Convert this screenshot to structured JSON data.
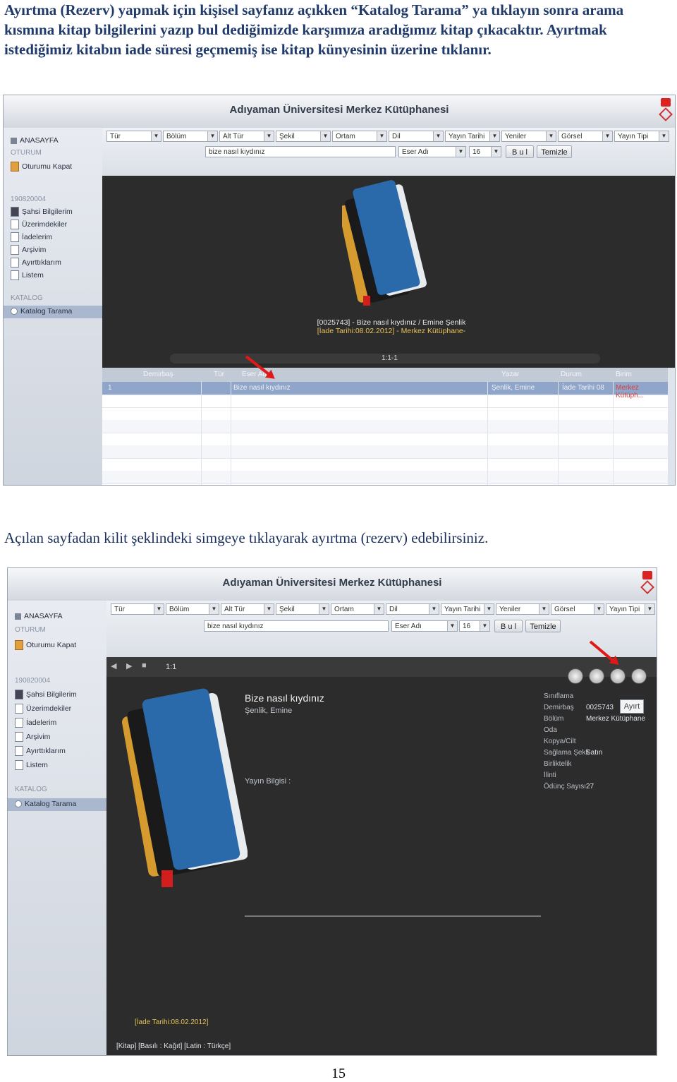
{
  "doc": {
    "para1": "Ayırtma (Rezerv) yapmak için kişisel sayfanız açıkken “Katalog Tarama” ya tıklayın sonra arama kısmına kitap bilgilerini yazıp bul dediğimizde karşımıza aradığımız kitap çıkacaktır. Ayırtmak istediğimiz kitabın iade süresi geçmemiş ise kitap künyesinin üzerine tıklanır.",
    "para2": "Açılan sayfadan kilit şeklindeki simgeye tıklayarak ayırtma (rezerv) edebilirsiniz.",
    "page_number": "15"
  },
  "app": {
    "title": "Adıyaman Üniversitesi Merkez Kütüphanesi",
    "sidebar": {
      "home": "ANASAYFA",
      "session_head": "OTURUM",
      "logout": "Oturumu Kapat",
      "user_id": "190820004",
      "items": [
        "Şahsi Bilgilerim",
        "Üzerimdekiler",
        "İadelerim",
        "Arşivim",
        "Ayırttıklarım",
        "Listem"
      ],
      "catalog_head": "KATALOG",
      "catalog_search": "Katalog Tarama"
    },
    "filters": {
      "dropdowns": [
        "Tür",
        "Bölüm",
        "Alt Tür",
        "Şekil",
        "Ortam",
        "Dil",
        "Yayın Tarihi",
        "Yeniler",
        "Görsel",
        "Yayın Tipi"
      ],
      "query": "bize nasıl kıydınız",
      "field": "Eser Adı",
      "count": "16",
      "find": "B u l",
      "clear": "Temizle"
    }
  },
  "shot1": {
    "caption_line1": "[0025743] - Bize nasıl kıydınız / Emine Şenlik",
    "caption_line2": "[İade Tarihi:08.02.2012] - Merkez Kütüphane-",
    "pager": "1:1-1",
    "grid_headers": [
      "Demirbaş",
      "Tür",
      "Eser Adı",
      "Yazar",
      "Durum",
      "Birim"
    ],
    "row": {
      "num": "1",
      "title": "Bize nasıl kıydınız",
      "author": "Şenlik, Emine",
      "date": "İade Tarihi 08",
      "unit": "Merkez Kütüph..."
    }
  },
  "shot2": {
    "pager": "1:1",
    "book_title": "Bize nasıl kıydınız",
    "book_author": "Şenlik, Emine",
    "publish_label": "Yayın Bilgisi :",
    "labels": [
      "Sınıflama",
      "Demirbaş",
      "Bölüm",
      "Oda",
      "Kopya/Cilt",
      "Sağlama Şekli",
      "Birliktelik",
      "İlinti",
      "Ödünç Sayısı"
    ],
    "demirbas": "0025743",
    "bolum": "Merkez Kütüphane",
    "saglama": "Satın",
    "odunc": "27",
    "reserve_button": "Ayırt",
    "return_date": "[İade Tarihi:08.02.2012]",
    "footer": "[Kitap] [Basılı : Kağıt] [Latin : Türkçe]"
  }
}
